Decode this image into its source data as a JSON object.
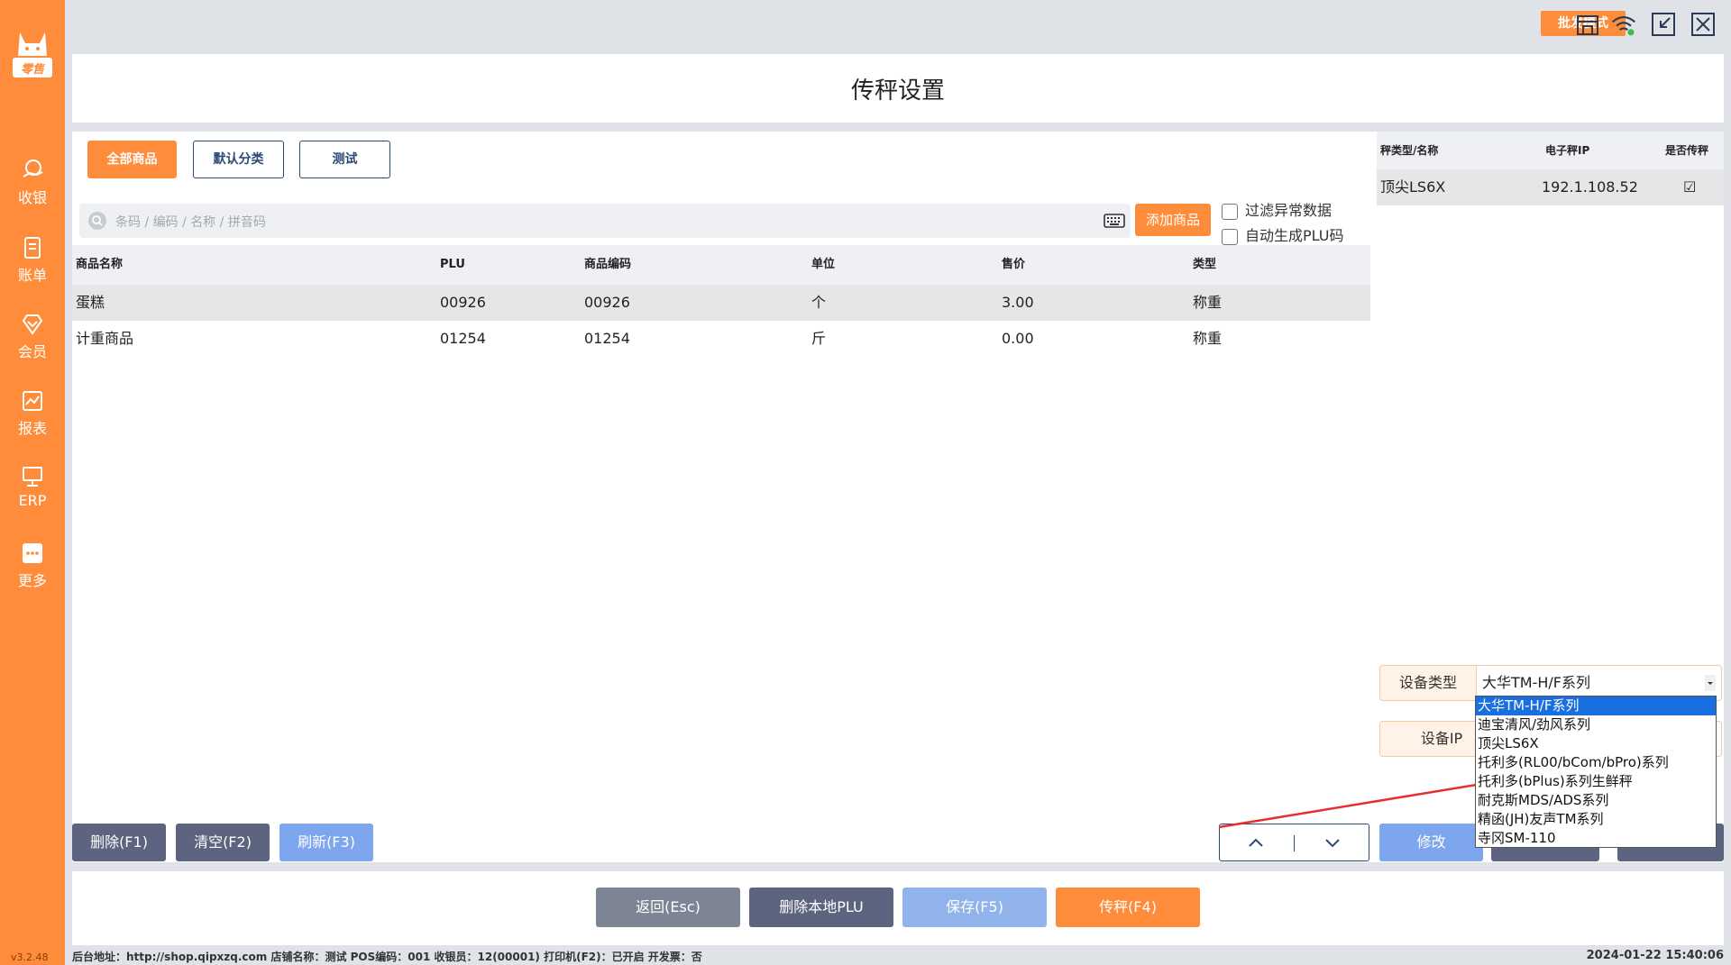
{
  "app": {
    "logo_text": "零售",
    "version": "v3.2.48"
  },
  "nav": [
    {
      "label": "收银",
      "icon": "cashier-icon"
    },
    {
      "label": "账单",
      "icon": "bill-icon"
    },
    {
      "label": "会员",
      "icon": "member-icon"
    },
    {
      "label": "报表",
      "icon": "report-icon"
    },
    {
      "label": "ERP",
      "icon": "erp-icon"
    },
    {
      "label": "更多",
      "icon": "more-icon"
    }
  ],
  "topbar": {
    "mode_label": "批发模式",
    "icons": [
      "store-icon",
      "wifi-icon",
      "shrink-window-icon",
      "close-icon"
    ]
  },
  "page": {
    "title": "传秤设置"
  },
  "categories": [
    {
      "label": "全部商品",
      "active": true
    },
    {
      "label": "默认分类",
      "active": false
    },
    {
      "label": "测试",
      "active": false
    }
  ],
  "search": {
    "placeholder": "条码 / 编码 / 名称 / 拼音码",
    "add_label": "添加商品"
  },
  "options": {
    "filter_abnormal": "过滤异常数据",
    "auto_plu": "自动生成PLU码"
  },
  "table": {
    "headers": [
      "商品名称",
      "PLU",
      "商品编码",
      "单位",
      "售价",
      "类型"
    ],
    "rows": [
      [
        "蛋糕",
        "00926",
        "00926",
        "个",
        "3.00",
        "称重"
      ],
      [
        "计重商品",
        "01254",
        "01254",
        "斤",
        "0.00",
        "称重"
      ]
    ]
  },
  "scales": {
    "headers": [
      "秤类型/名称",
      "电子秤IP",
      "是否传秤"
    ],
    "rows": [
      {
        "name": "顶尖LS6X",
        "ip": "192.1.108.52",
        "checked": "☑"
      }
    ]
  },
  "device": {
    "type_label": "设备类型",
    "type_value": "大华TM-H/F系列",
    "ip_label": "设备IP",
    "options": [
      "大华TM-H/F系列",
      "迪宝清风/劲风系列",
      "顶尖LS6X",
      "托利多(RL00/bCom/bPro)系列",
      "托利多(bPlus)系列生鲜秤",
      "耐克斯MDS/ADS系列",
      "精函(JH)友声TM系列",
      "寺冈SM-110"
    ],
    "modify_label": "修改"
  },
  "actions": {
    "delete": "删除(F1)",
    "clear": "清空(F2)",
    "refresh": "刷新(F3)"
  },
  "footer": {
    "back": "返回(Esc)",
    "delete_plu": "删除本地PLU",
    "save": "保存(F5)",
    "transfer": "传秤(F4)"
  },
  "status": {
    "text": "后台地址：http://shop.qipxzq.com  店铺名称：测试  POS编码：001  收银员：12(00001)  打印机(F2)：已开启  开发票：否",
    "datetime": "2024-01-22 15:40:06"
  },
  "colors": {
    "accent": "#ff8c3a",
    "dark_button": "#5d6480",
    "light_blue": "#7ea6ef",
    "selection": "#1a6fe0"
  }
}
